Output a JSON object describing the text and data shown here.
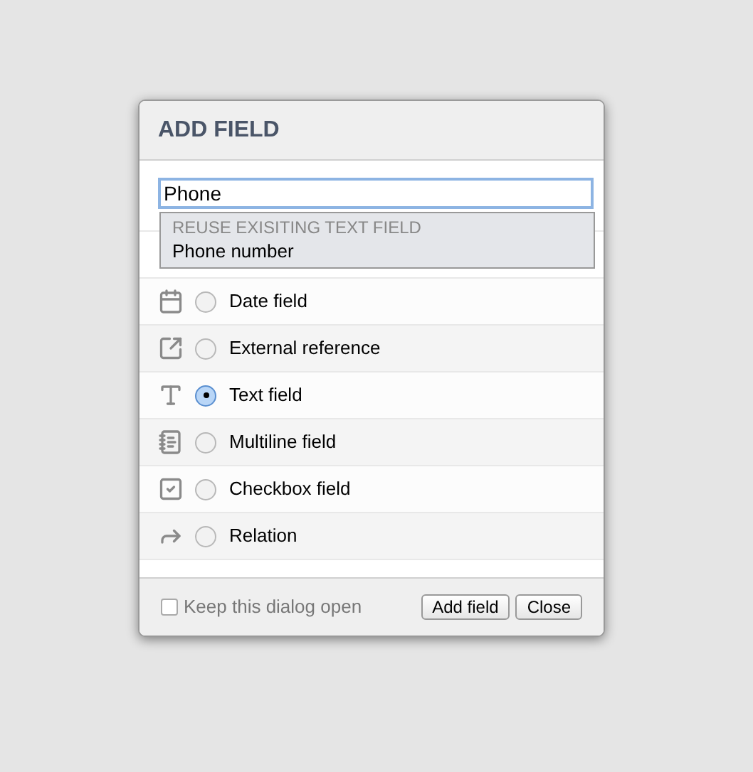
{
  "dialog": {
    "title": "ADD FIELD"
  },
  "search": {
    "value": "Phone"
  },
  "suggestions": {
    "heading": "REUSE EXISITING TEXT FIELD",
    "items": [
      "Phone number"
    ]
  },
  "field_types": [
    {
      "kind": "date",
      "label": "Date field",
      "selected": false
    },
    {
      "kind": "external",
      "label": "External reference",
      "selected": false
    },
    {
      "kind": "text",
      "label": "Text field",
      "selected": true
    },
    {
      "kind": "multiline",
      "label": "Multiline field",
      "selected": false
    },
    {
      "kind": "checkbox",
      "label": "Checkbox field",
      "selected": false
    },
    {
      "kind": "relation",
      "label": "Relation",
      "selected": false
    }
  ],
  "keep_open": {
    "label": "Keep this dialog open",
    "checked": false
  },
  "buttons": [
    "Add field",
    "Close"
  ]
}
